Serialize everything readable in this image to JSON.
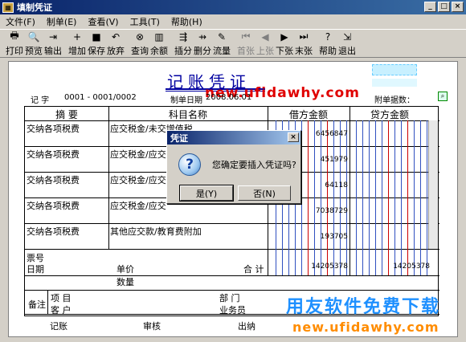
{
  "window": {
    "title": "填制凭证",
    "min": "_",
    "max": "□",
    "close": "×"
  },
  "menu": [
    "文件(F)",
    "制单(E)",
    "查看(V)",
    "工具(T)",
    "帮助(H)"
  ],
  "toolbar": [
    {
      "label": "打印",
      "icon": "printer-icon",
      "glyph": "🖶",
      "enabled": true
    },
    {
      "label": "预览",
      "icon": "preview-icon",
      "glyph": "🔍",
      "enabled": true
    },
    {
      "label": "输出",
      "icon": "export-icon",
      "glyph": "⇥",
      "enabled": true
    },
    {
      "label": "增加",
      "icon": "add-icon",
      "glyph": "+",
      "enabled": true
    },
    {
      "label": "保存",
      "icon": "save-icon",
      "glyph": "■",
      "enabled": true
    },
    {
      "label": "放弃",
      "icon": "undo-icon",
      "glyph": "↶",
      "enabled": true
    },
    {
      "label": "查询",
      "icon": "binoculars-icon",
      "glyph": "⊗",
      "enabled": true
    },
    {
      "label": "余额",
      "icon": "balance-chart-icon",
      "glyph": "▥",
      "enabled": true
    },
    {
      "label": "插分",
      "icon": "insert-row-icon",
      "glyph": "⇶",
      "enabled": true
    },
    {
      "label": "删分",
      "icon": "delete-row-icon",
      "glyph": "⇸",
      "enabled": true
    },
    {
      "label": "流量",
      "icon": "cashflow-icon",
      "glyph": "✎",
      "enabled": true
    },
    {
      "label": "首张",
      "icon": "first-icon",
      "glyph": "⏮",
      "enabled": false
    },
    {
      "label": "上张",
      "icon": "prev-icon",
      "glyph": "◀",
      "enabled": false
    },
    {
      "label": "下张",
      "icon": "next-icon",
      "glyph": "▶",
      "enabled": true
    },
    {
      "label": "末张",
      "icon": "last-icon",
      "glyph": "⏭",
      "enabled": true
    },
    {
      "label": "帮助",
      "icon": "help-icon",
      "glyph": "?",
      "enabled": true
    },
    {
      "label": "退出",
      "icon": "exit-icon",
      "glyph": "⇲",
      "enabled": true
    }
  ],
  "voucher": {
    "title": "记账凭证",
    "type_label": "记 字",
    "number": "0001 - 0001/0002",
    "date_label": "制单日期",
    "date": "2008.06.01",
    "attach_label": "附单据数：",
    "headers": {
      "summary": "摘 要",
      "account": "科目名称",
      "debit": "借方金额",
      "credit": "贷方金额"
    },
    "rows": [
      {
        "summary": "交纳各项税费",
        "account": "应交税金/未交增值税",
        "debit": "6456847"
      },
      {
        "summary": "交纳各项税费",
        "account": "应交税金/应交",
        "debit": "451979"
      },
      {
        "summary": "交纳各项税费",
        "account": "应交税金/应交",
        "debit": "64118"
      },
      {
        "summary": "交纳各项税费",
        "account": "应交税金/应交",
        "debit": "7038729"
      },
      {
        "summary": "交纳各项税费",
        "account": "其他应交款/教育费附加",
        "debit": "193705"
      }
    ],
    "footer": {
      "ticket": "票号",
      "date": "日期",
      "price": "单价",
      "qty": "数量",
      "total": "合 计",
      "total_debit": "14205378",
      "total_credit": "14205378"
    },
    "remarks": {
      "label": "备注",
      "project": "项 目",
      "customer": "客 户",
      "dept": "部 门",
      "salesman": "业务员"
    },
    "signers": {
      "bookkeep": "记账",
      "audit": "审核",
      "cashier": "出纳"
    }
  },
  "dialog": {
    "title": "凭证",
    "message": "您确定要插入凭证吗?",
    "yes": "是(Y)",
    "no": "否(N)",
    "close": "×",
    "icon": "question-icon"
  },
  "watermarks": {
    "top": "new.ufidawhy.com",
    "brand": "用友软件免费下载",
    "bottom": "new.ufidawhy.com"
  }
}
